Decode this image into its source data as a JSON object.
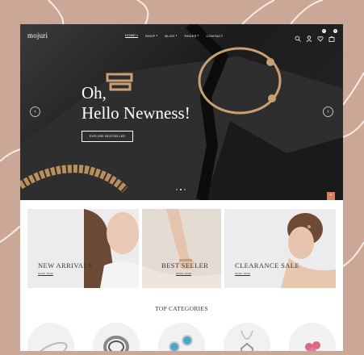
{
  "header": {
    "logo": "mojuri",
    "menu": [
      {
        "label": "HOME",
        "caret": "▾"
      },
      {
        "label": "SHOP",
        "caret": "▾"
      },
      {
        "label": "BLOG",
        "caret": "▾"
      },
      {
        "label": "PAGES",
        "caret": "▾"
      },
      {
        "label": "CONTACT",
        "caret": ""
      }
    ],
    "icons": [
      "search-icon",
      "user-icon",
      "heart-icon",
      "cart-icon"
    ],
    "wishlist_count": "0",
    "cart_count": "0"
  },
  "hero": {
    "title_line1": "Oh,",
    "title_line2": "Hello Newness!",
    "cta": "EXPLORE BESTSELLER",
    "prev": "‹",
    "next": "›",
    "slides": 3,
    "active_slide": 2
  },
  "banners": [
    {
      "title": "NEW ARRIVALS",
      "link": "SHOP NOW"
    },
    {
      "title": "BEST SELLER",
      "link": "SHOP NOW"
    },
    {
      "title": "CLEARANCE SALE",
      "link": "SHOP NOW"
    }
  ],
  "categories": {
    "title": "TOP CATEGORIES",
    "items": [
      "bracelet",
      "ring",
      "earrings",
      "necklace",
      "charm"
    ]
  },
  "scroll_top": "⌃",
  "colors": {
    "page_bg": "#cba895",
    "accent": "#d9805a",
    "gold": "#c9a070"
  }
}
